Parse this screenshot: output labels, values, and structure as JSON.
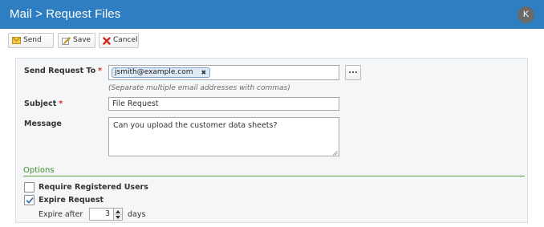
{
  "header": {
    "title": "Mail > Request Files",
    "avatar_letter": "K",
    "bar_color": "#2f7ec2"
  },
  "toolbar": {
    "send_label": "Send",
    "send_icon": "envelope-icon",
    "save_label": "Save",
    "save_icon": "pencil-icon",
    "cancel_label": "Cancel",
    "cancel_icon": "red-x-icon"
  },
  "form": {
    "send_to": {
      "label": "Send Request To",
      "required_mark": "*",
      "recipients": [
        "jsmith@example.com"
      ],
      "remove_glyph": "✖",
      "browse_label": "...",
      "hint": "(Separate multiple email addresses with commas)"
    },
    "subject": {
      "label": "Subject",
      "required_mark": "*",
      "value": "File Request"
    },
    "message": {
      "label": "Message",
      "value": "Can you upload the customer data sheets?"
    }
  },
  "options": {
    "heading": "Options",
    "require_registered": {
      "label": "Require Registered Users",
      "checked": false
    },
    "expire_request": {
      "label": "Expire Request",
      "checked": true
    },
    "expire_after": {
      "prefix": "Expire after",
      "value": "3",
      "suffix": "days"
    }
  },
  "colors": {
    "accent": "#2f7ec2",
    "required": "#d42b1e",
    "options_green": "#3f8a2c"
  }
}
